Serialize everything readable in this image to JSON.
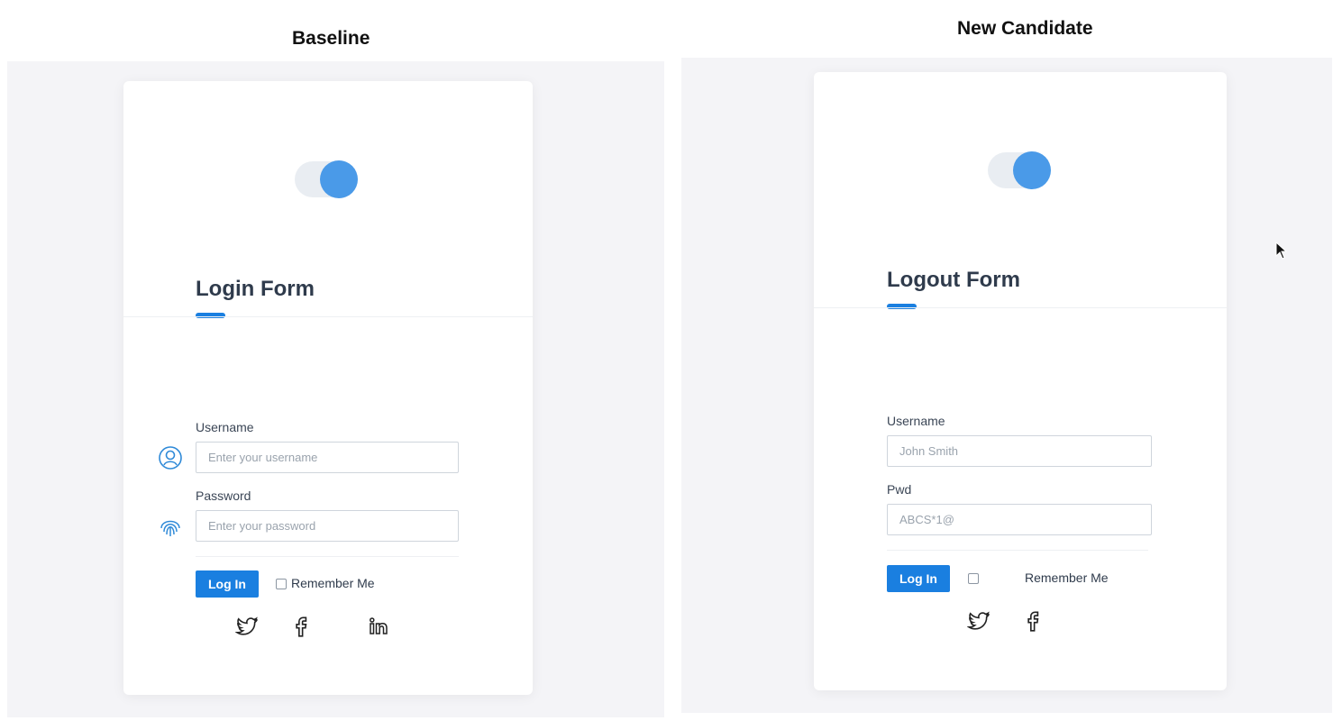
{
  "baseline": {
    "heading": "Baseline",
    "form_title": "Login Form",
    "username_label": "Username",
    "username_placeholder": "Enter your username",
    "password_label": "Password",
    "password_placeholder": "Enter your password",
    "login_button": "Log In",
    "remember_label": "Remember Me",
    "social_icons": [
      "twitter-icon",
      "facebook-icon",
      "linkedin-icon"
    ]
  },
  "candidate": {
    "heading": "New Candidate",
    "form_title": "Logout Form",
    "username_label": "Username",
    "username_value": "John Smith",
    "password_label": "Pwd",
    "password_value": "ABCS*1@",
    "login_button": "Log In",
    "remember_label": "Remember Me",
    "social_icons": [
      "twitter-icon",
      "facebook-icon"
    ]
  },
  "colors": {
    "accent": "#1a7fe0",
    "toggle_knob": "#4a9ae8",
    "panel_background": "#f4f4f7"
  }
}
